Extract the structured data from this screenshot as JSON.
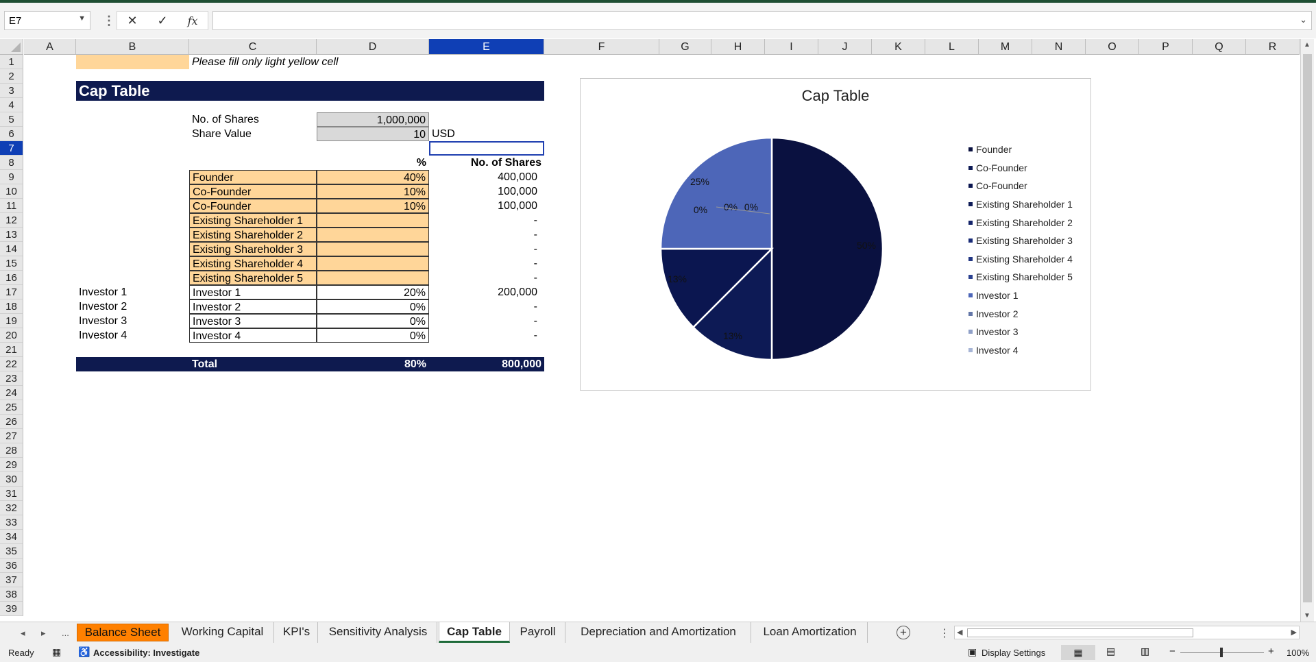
{
  "formula_bar": {
    "name_box": "E7",
    "formula": "",
    "cancel_icon": "✕",
    "enter_icon": "✓",
    "fx_icon": "fx"
  },
  "columns": [
    "A",
    "B",
    "C",
    "D",
    "E",
    "F",
    "G",
    "H",
    "I",
    "J",
    "K",
    "L",
    "M",
    "N",
    "O",
    "P",
    "Q",
    "R"
  ],
  "rows": [
    "1",
    "2",
    "3",
    "4",
    "5",
    "6",
    "7",
    "8",
    "9",
    "10",
    "11",
    "12",
    "13",
    "14",
    "15",
    "16",
    "17",
    "18",
    "19",
    "20",
    "21",
    "22",
    "23",
    "24",
    "25",
    "26",
    "27",
    "28",
    "29",
    "30",
    "31",
    "32",
    "33",
    "34",
    "35",
    "36",
    "37",
    "38",
    "39"
  ],
  "sheet": {
    "note": "Please fill only light yellow cell",
    "title": "Cap Table",
    "shares_label": "No. of Shares",
    "shares_value": "1,000,000",
    "share_value_label": "Share Value",
    "share_value": "10",
    "currency": "USD",
    "pct_header": "%",
    "shares_header": "No. of Shares",
    "table": [
      {
        "side": "",
        "name": "Founder",
        "pct": "40%",
        "shares": "400,000",
        "peach": true
      },
      {
        "side": "",
        "name": "Co-Founder",
        "pct": "10%",
        "shares": "100,000",
        "peach": true
      },
      {
        "side": "",
        "name": "Co-Founder",
        "pct": "10%",
        "shares": "100,000",
        "peach": true
      },
      {
        "side": "",
        "name": "Existing Shareholder 1",
        "pct": "",
        "shares": "-",
        "peach": true
      },
      {
        "side": "",
        "name": "Existing Shareholder 2",
        "pct": "",
        "shares": "-",
        "peach": true
      },
      {
        "side": "",
        "name": "Existing Shareholder 3",
        "pct": "",
        "shares": "-",
        "peach": true
      },
      {
        "side": "",
        "name": "Existing Shareholder 4",
        "pct": "",
        "shares": "-",
        "peach": true
      },
      {
        "side": "",
        "name": "Existing Shareholder 5",
        "pct": "",
        "shares": "-",
        "peach": true
      },
      {
        "side": "Investor 1",
        "name": "Investor 1",
        "pct": "20%",
        "shares": "200,000",
        "peach": false
      },
      {
        "side": "Investor 2",
        "name": "Investor 2",
        "pct": "0%",
        "shares": "-",
        "peach": false
      },
      {
        "side": "Investor 3",
        "name": "Investor 3",
        "pct": "0%",
        "shares": "-",
        "peach": false
      },
      {
        "side": "Investor 4",
        "name": "Investor 4",
        "pct": "0%",
        "shares": "-",
        "peach": false
      }
    ],
    "total_label": "Total",
    "total_pct": "80%",
    "total_shares": "800,000"
  },
  "chart_data": {
    "type": "pie",
    "title": "Cap Table",
    "categories": [
      "Founder",
      "Co-Founder",
      "Co-Founder",
      "Existing Shareholder 1",
      "Existing Shareholder 2",
      "Existing Shareholder 3",
      "Existing Shareholder 4",
      "Existing Shareholder 5",
      "Investor 1",
      "Investor 2",
      "Investor 3",
      "Investor 4"
    ],
    "values": [
      50,
      12.5,
      12.5,
      0,
      0,
      0,
      0,
      0,
      25,
      0,
      0,
      0
    ],
    "colors": [
      "#0a1140",
      "#0d1a55",
      "#0b1650",
      "#0e1b57",
      "#14246a",
      "#1a2c78",
      "#223683",
      "#2b4190",
      "#4d66b8",
      "#6477a8",
      "#8fa0c8",
      "#a7b5d6"
    ],
    "data_labels": [
      "50%",
      "13%",
      "13%",
      "0%",
      "0%",
      "0%",
      "25%"
    ],
    "legend_position": "right"
  },
  "tabs": [
    {
      "label": "Balance Sheet",
      "style": "orange"
    },
    {
      "label": "Working Capital",
      "style": ""
    },
    {
      "label": "KPI's",
      "style": ""
    },
    {
      "label": "Sensitivity Analysis",
      "style": ""
    },
    {
      "label": "Cap Table",
      "style": "active"
    },
    {
      "label": "Payroll",
      "style": ""
    },
    {
      "label": "Depreciation and Amortization",
      "style": ""
    },
    {
      "label": "Loan Amortization",
      "style": ""
    }
  ],
  "tab_nav": {
    "prev": "◂",
    "next": "▸",
    "more": "..."
  },
  "status": {
    "ready": "Ready",
    "accessibility": "Accessibility: Investigate",
    "display_settings": "Display Settings",
    "zoom": "100%"
  }
}
